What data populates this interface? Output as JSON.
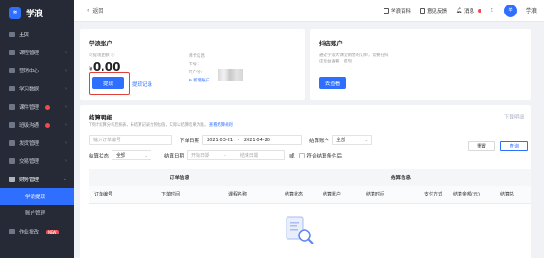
{
  "sidebar": {
    "brand": "学浪",
    "items": [
      {
        "label": "主页"
      },
      {
        "label": "课程管理",
        "chevron": "›"
      },
      {
        "label": "营销中心",
        "chevron": "›"
      },
      {
        "label": "学习数据",
        "chevron": "›"
      },
      {
        "label": "课件管理",
        "chevron": "›"
      },
      {
        "label": "班级沟通",
        "chevron": "›"
      },
      {
        "label": "发货管理",
        "chevron": "›"
      },
      {
        "label": "交易管理",
        "chevron": "›"
      },
      {
        "label": "财务管理",
        "chevron": "⌄"
      }
    ],
    "sub_items": [
      {
        "label": "学浪提现"
      },
      {
        "label": "账户管理"
      }
    ],
    "last_item": {
      "label": "作业批改",
      "tag": "NEW"
    }
  },
  "topbar": {
    "back": "返回",
    "links": [
      "学浪百科",
      "意见反馈",
      "消息"
    ],
    "avatar_text": "学",
    "user": "学浪"
  },
  "account_card": {
    "title": "学浪账户",
    "balance_label": "可提现金额",
    "currency": "¥",
    "balance": "0.00",
    "withdraw_btn": "提现",
    "record_link": "提现记录",
    "info": [
      "绑卡信息",
      "卡号：",
      "开户行：",
      "开户名："
    ],
    "info_link": "新增账户"
  },
  "shop_card": {
    "title": "抖店账户",
    "desc": "通过学浪大课堂销售的订单，需要在抖店后台查看、提现",
    "view_btn": "去查看"
  },
  "detail": {
    "title": "结算明细",
    "tip": "T预计结算分析后报表，未结算记录为预估值，实际以结算结果为准。",
    "tip_link": "查看结算规则",
    "download": "下载明细",
    "order_placeholder": "输入订单编号",
    "order_time_label": "下单日期",
    "date_start": "2021-03-21",
    "date_sep": "-",
    "date_end": "2021-04-20",
    "settle_type_label": "结算账户",
    "settle_type_value": "全部",
    "status_label": "结算状态",
    "status_value": "全部",
    "settle_date_label": "结算日期",
    "start_placeholder": "开始日期",
    "end_placeholder": "结束日期",
    "or": "或",
    "checkbox_label": "符合结算条件后",
    "reset_btn": "重置",
    "query_btn": "查询"
  },
  "table": {
    "group_headers": [
      "订单信息",
      "结算信息"
    ],
    "headers": [
      "订单编号",
      "下单时间",
      "课程名称",
      "结算状态",
      "结算账户",
      "结算时间",
      "支付方式",
      "结算金额(元)",
      "结算总"
    ]
  }
}
